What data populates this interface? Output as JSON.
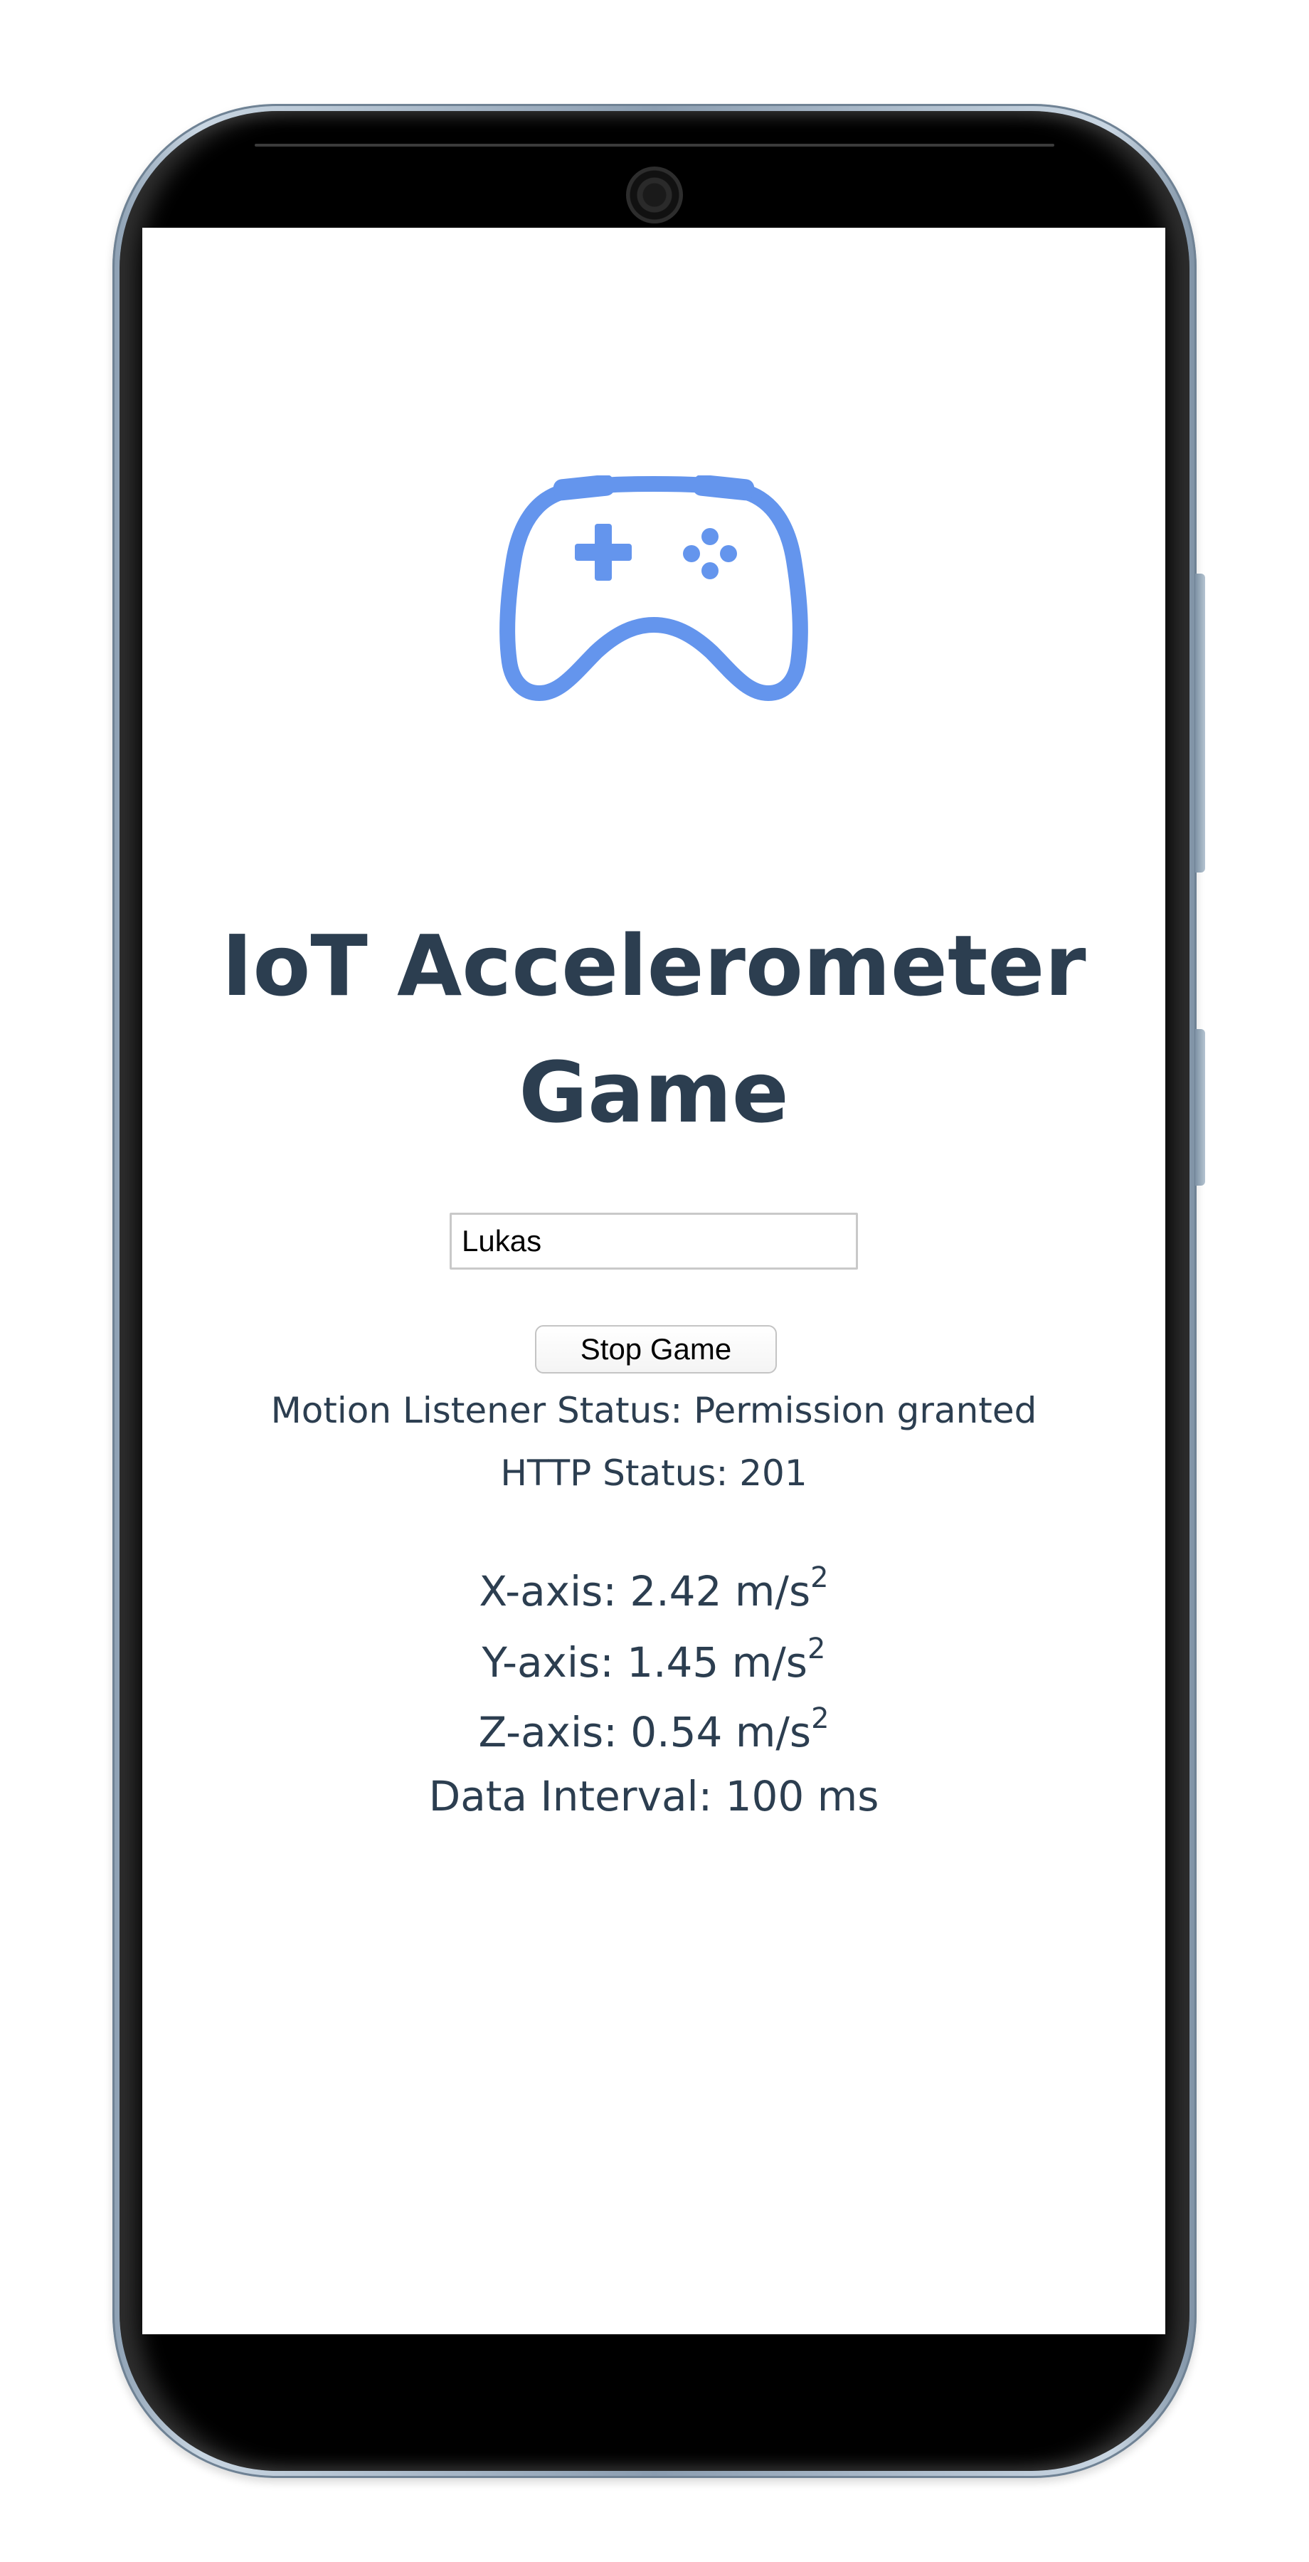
{
  "app": {
    "title_line1": "IoT Accelerometer",
    "title_line2": "Game",
    "logo_icon": "gamepad-icon",
    "accent_color": "#6495ED",
    "text_color": "#2c3e50"
  },
  "form": {
    "name_value": "Lukas",
    "stop_button_label": "Stop Game"
  },
  "status": {
    "motion_listener": "Motion Listener Status: Permission granted",
    "http": "HTTP Status: 201"
  },
  "readings": {
    "x_label": "X-axis: 2.42 m/s",
    "y_label": "Y-axis: 1.45 m/s",
    "z_label": "Z-axis: 0.54 m/s",
    "unit_exponent": "2",
    "interval": "Data Interval: 100 ms"
  }
}
